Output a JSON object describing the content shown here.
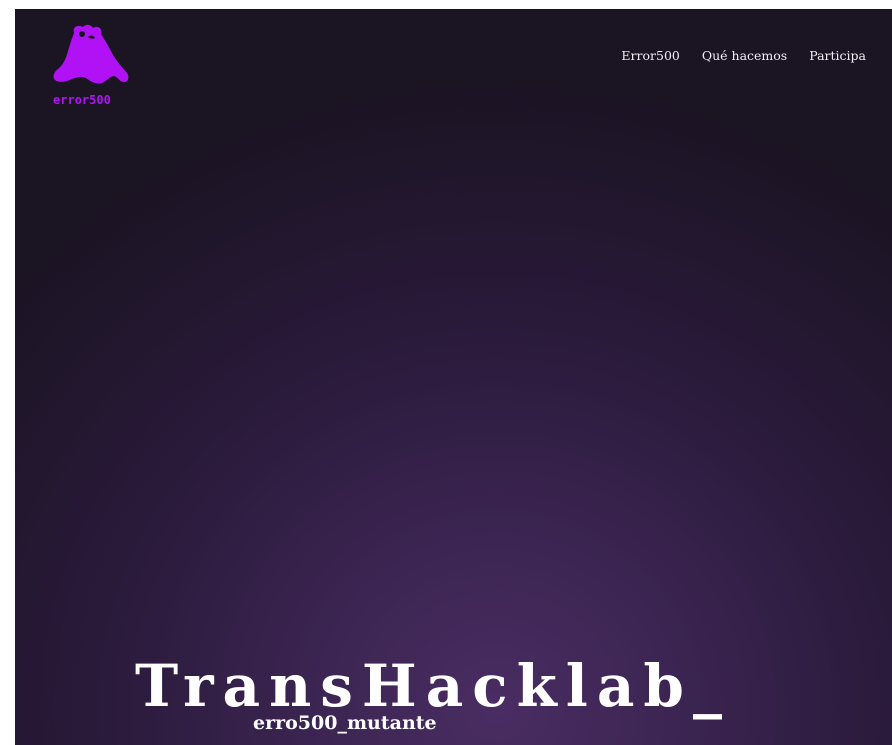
{
  "brand": {
    "logo_text": "error500",
    "logo_icon": "mutant-creature-icon",
    "accent_color": "#b012f5"
  },
  "nav": {
    "items": [
      {
        "label": "Error500"
      },
      {
        "label": "Qué hacemos"
      },
      {
        "label": "Participa"
      }
    ]
  },
  "hero": {
    "title": "TransHacklab_",
    "subtitle": "erro500_mutante"
  },
  "colors": {
    "background_dark": "#1b1423",
    "background_glow": "#4a2d63",
    "text": "#ffffff"
  }
}
